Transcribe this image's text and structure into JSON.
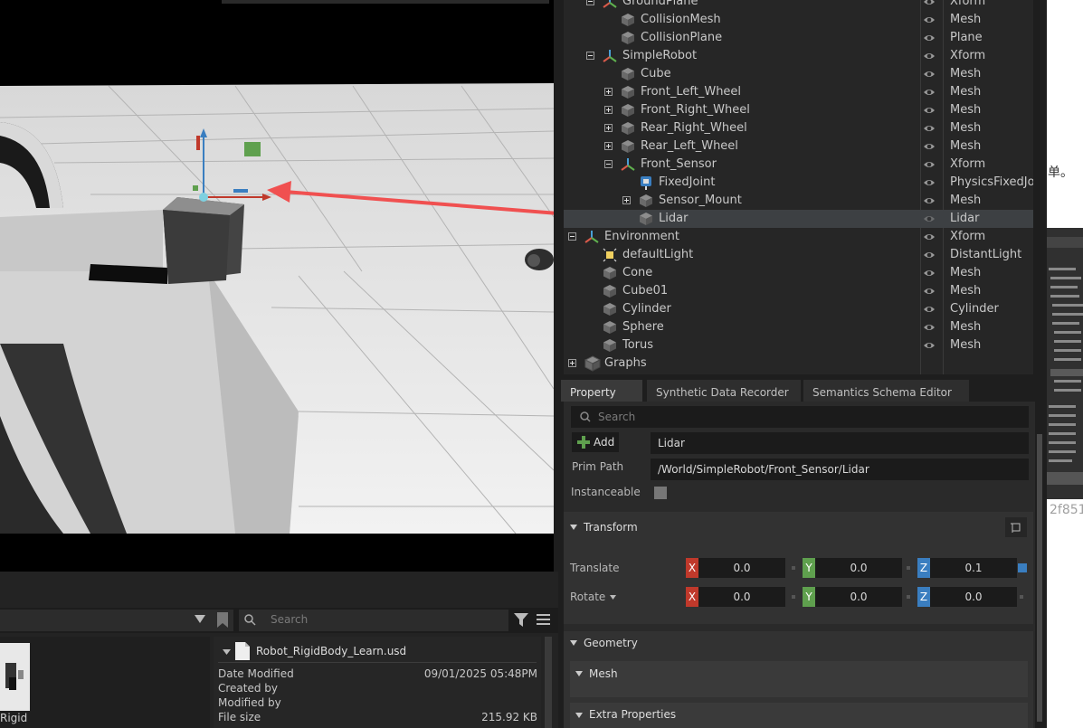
{
  "stage": {
    "rows": [
      {
        "name": "GroundPlane",
        "type": "Xform",
        "indent": 0,
        "kind": "xform",
        "expander": "minus"
      },
      {
        "name": "CollisionMesh",
        "type": "Mesh",
        "indent": 1,
        "kind": "mesh",
        "expander": ""
      },
      {
        "name": "CollisionPlane",
        "type": "Plane",
        "indent": 1,
        "kind": "mesh",
        "expander": ""
      },
      {
        "name": "SimpleRobot",
        "type": "Xform",
        "indent": 0,
        "kind": "xform",
        "expander": "minus"
      },
      {
        "name": "Cube",
        "type": "Mesh",
        "indent": 1,
        "kind": "mesh",
        "expander": ""
      },
      {
        "name": "Front_Left_Wheel",
        "type": "Mesh",
        "indent": 1,
        "kind": "mesh",
        "expander": "plus"
      },
      {
        "name": "Front_Right_Wheel",
        "type": "Mesh",
        "indent": 1,
        "kind": "mesh",
        "expander": "plus"
      },
      {
        "name": "Rear_Right_Wheel",
        "type": "Mesh",
        "indent": 1,
        "kind": "mesh",
        "expander": "plus"
      },
      {
        "name": "Rear_Left_Wheel",
        "type": "Mesh",
        "indent": 1,
        "kind": "mesh",
        "expander": "plus"
      },
      {
        "name": "Front_Sensor",
        "type": "Xform",
        "indent": 1,
        "kind": "xform",
        "expander": "minus"
      },
      {
        "name": "FixedJoint",
        "type": "PhysicsFixedJoint",
        "indent": 2,
        "kind": "joint",
        "expander": ""
      },
      {
        "name": "Sensor_Mount",
        "type": "Mesh",
        "indent": 2,
        "kind": "mesh",
        "expander": "plus"
      },
      {
        "name": "Lidar",
        "type": "Lidar",
        "indent": 2,
        "kind": "mesh",
        "expander": "",
        "selected": true
      },
      {
        "name": "Environment",
        "type": "Xform",
        "indent": -1,
        "kind": "xform",
        "expander": "minus"
      },
      {
        "name": "defaultLight",
        "type": "DistantLight",
        "indent": 0,
        "kind": "light",
        "expander": ""
      },
      {
        "name": "Cone",
        "type": "Mesh",
        "indent": 0,
        "kind": "mesh",
        "expander": ""
      },
      {
        "name": "Cube01",
        "type": "Mesh",
        "indent": 0,
        "kind": "mesh",
        "expander": ""
      },
      {
        "name": "Cylinder",
        "type": "Cylinder",
        "indent": 0,
        "kind": "mesh",
        "expander": ""
      },
      {
        "name": "Sphere",
        "type": "Mesh",
        "indent": 0,
        "kind": "mesh",
        "expander": ""
      },
      {
        "name": "Torus",
        "type": "Mesh",
        "indent": 0,
        "kind": "mesh",
        "expander": ""
      },
      {
        "name": "Graphs",
        "type": "",
        "indent": -1,
        "kind": "graph",
        "expander": "plus",
        "noeye": true
      }
    ]
  },
  "tabs": [
    "Property",
    "Synthetic Data Recorder",
    "Semantics Schema Editor"
  ],
  "property": {
    "search_placeholder": "Search",
    "add_label": "Add",
    "name_value": "Lidar",
    "prim_path_label": "Prim Path",
    "prim_path_value": "/World/SimpleRobot/Front_Sensor/Lidar",
    "instanceable_label": "Instanceable",
    "transform_label": "Transform",
    "translate_label": "Translate",
    "rotate_label": "Rotate",
    "translate": {
      "x": "0.0",
      "y": "0.0",
      "z": "0.1"
    },
    "rotate": {
      "x": "0.0",
      "y": "0.0",
      "z": "0.0"
    },
    "axis_x": "X",
    "axis_y": "Y",
    "axis_z": "Z",
    "geometry_label": "Geometry",
    "mesh_label": "Mesh",
    "extra_label": "Extra Properties"
  },
  "content": {
    "search_placeholder": "Search",
    "file_name": "Robot_RigidBody_Learn.usd",
    "thumb_label": "Rigid",
    "meta": [
      {
        "label": "Date Modified",
        "value": "09/01/2025 05:48PM"
      },
      {
        "label": "Created by",
        "value": ""
      },
      {
        "label": "Modified by",
        "value": ""
      },
      {
        "label": "File size",
        "value": "215.92 KB"
      }
    ]
  },
  "right_strip": {
    "text": "单。",
    "hash": "2f851"
  },
  "colors": {
    "axis_x": "#c0392b",
    "axis_y": "#5fa04e",
    "axis_z": "#3a7ec0",
    "annotation_arrow": "#f05050"
  }
}
